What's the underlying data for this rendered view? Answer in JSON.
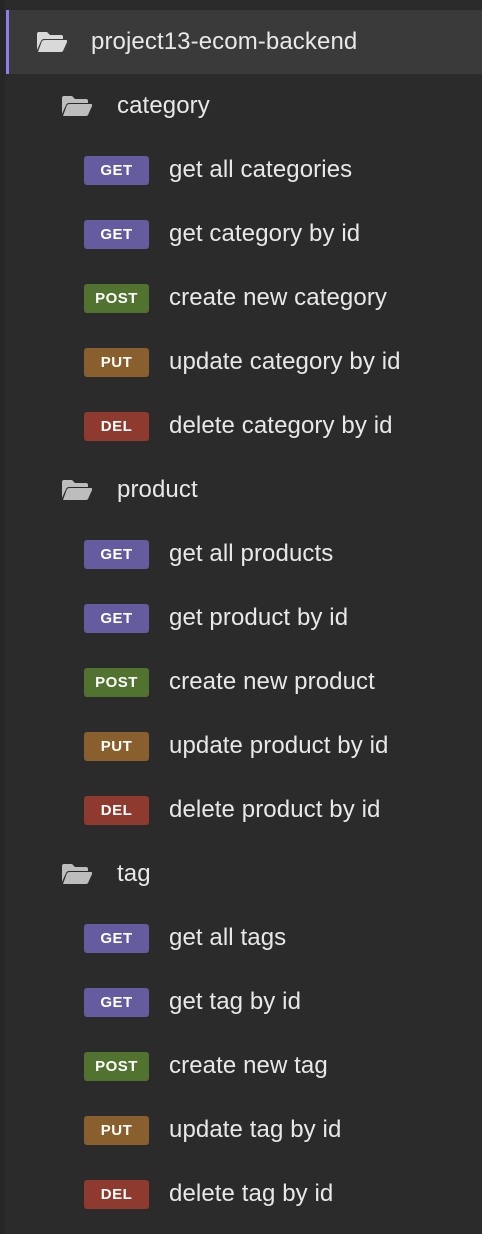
{
  "collection": {
    "name": "project13-ecom-backend",
    "icon": "folder-open-icon",
    "accent": "#8b7cf0"
  },
  "method_colors": {
    "GET": "#645c9f",
    "POST": "#51732f",
    "PUT": "#8a5f2e",
    "DEL": "#8f3a2f"
  },
  "folders": [
    {
      "name": "category",
      "icon": "folder-open-icon",
      "requests": [
        {
          "method": "GET",
          "name": "get all categories"
        },
        {
          "method": "GET",
          "name": "get category by id"
        },
        {
          "method": "POST",
          "name": "create new category"
        },
        {
          "method": "PUT",
          "name": "update category by id"
        },
        {
          "method": "DEL",
          "name": "delete category by id"
        }
      ]
    },
    {
      "name": "product",
      "icon": "folder-open-icon",
      "requests": [
        {
          "method": "GET",
          "name": "get all products"
        },
        {
          "method": "GET",
          "name": "get product by id"
        },
        {
          "method": "POST",
          "name": "create new product"
        },
        {
          "method": "PUT",
          "name": "update product by id"
        },
        {
          "method": "DEL",
          "name": "delete product by id"
        }
      ]
    },
    {
      "name": "tag",
      "icon": "folder-open-icon",
      "requests": [
        {
          "method": "GET",
          "name": "get all tags"
        },
        {
          "method": "GET",
          "name": "get tag by id"
        },
        {
          "method": "POST",
          "name": "create new tag"
        },
        {
          "method": "PUT",
          "name": "update tag by id"
        },
        {
          "method": "DEL",
          "name": "delete tag by id"
        }
      ]
    }
  ]
}
